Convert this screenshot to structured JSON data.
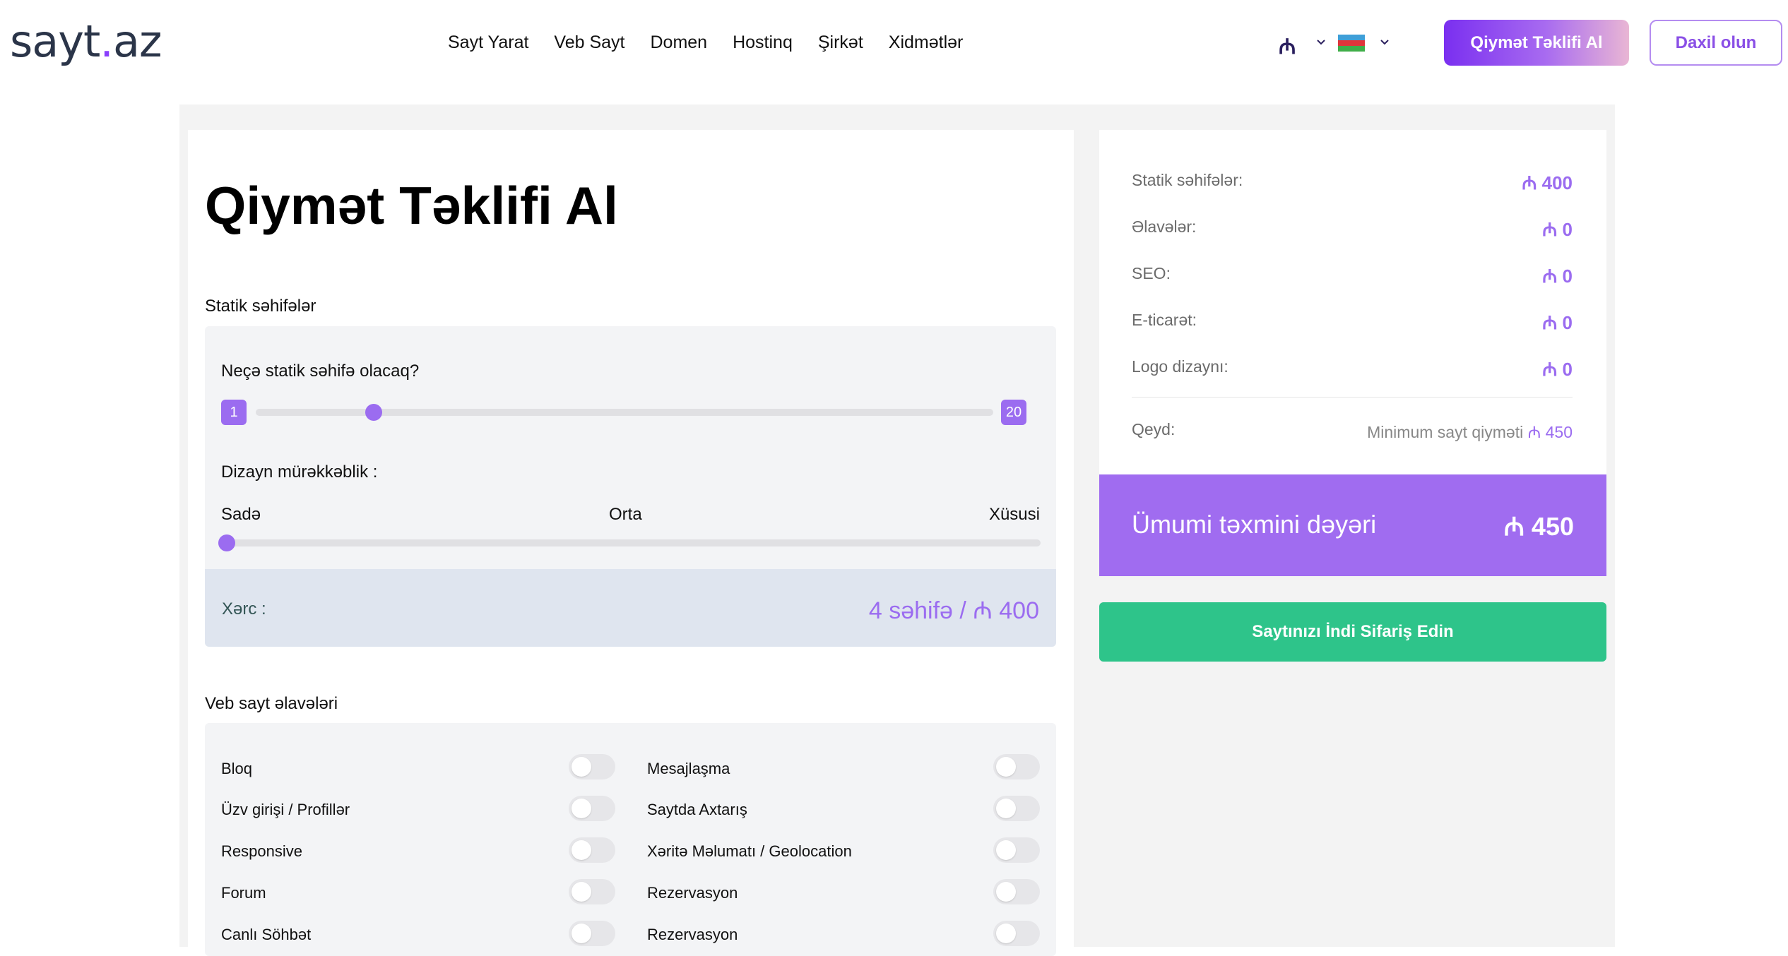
{
  "header": {
    "logo_main": "sayt",
    "logo_dot": ".",
    "logo_tld": "az",
    "nav": [
      "Sayt Yarat",
      "Veb Sayt",
      "Domen",
      "Hostinq",
      "Şirkət",
      "Xidmətlər"
    ],
    "currency_symbol": "₼",
    "quote_button": "Qiymət Təklifi Al",
    "login_button": "Daxil olun"
  },
  "page": {
    "title": "Qiymət Təklifi Al"
  },
  "static_pages": {
    "section_label": "Statik səhifələr",
    "question": "Neçə statik səhifə olacaq?",
    "min": "1",
    "max": "20",
    "value_fraction": 0.16,
    "design_label": "Dizayn mürəkkəblik :",
    "design_levels": [
      "Sadə",
      "Orta",
      "Xüsusi"
    ],
    "design_value_fraction": 0.0,
    "cost_label": "Xərc :",
    "cost_value": "4 səhifə / ₼ 400"
  },
  "addons": {
    "section_label": "Veb sayt əlavələri",
    "left": [
      "Bloq",
      "Üzv girişi / Profillər",
      "Responsive",
      "Forum",
      "Canlı Söhbət"
    ],
    "right": [
      "Mesajlaşma",
      "Saytda Axtarış",
      "Xəritə Məlumatı / Geolocation",
      "Rezervasyon",
      "Rezervasyon"
    ]
  },
  "summary": {
    "rows": [
      {
        "label": "Statik səhifələr:",
        "value": "₼ 400"
      },
      {
        "label": "Əlavələr:",
        "value": "₼ 0"
      },
      {
        "label": "SEO:",
        "value": "₼ 0"
      },
      {
        "label": "E-ticarət:",
        "value": "₼ 0"
      },
      {
        "label": "Logo dizaynı:",
        "value": "₼ 0"
      }
    ],
    "note_label": "Qeyd:",
    "note_text": "Minimum sayt qiyməti ",
    "note_amount": "₼ 450",
    "total_label": "Ümumi təxmini dəyəri",
    "total_value": "₼ 450",
    "order_button": "Saytınızı İndi Sifariş Edin"
  },
  "colors": {
    "accent": "#9b6cf0",
    "order_green": "#2ec48a",
    "cost_bar": "#dfe5ef"
  }
}
